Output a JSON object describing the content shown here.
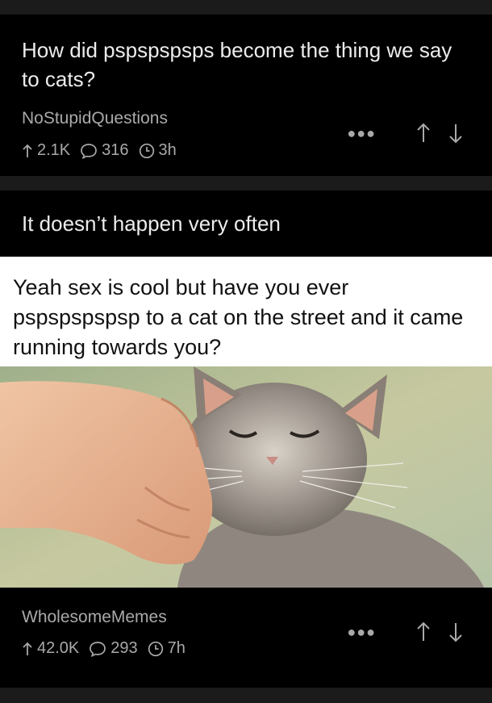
{
  "posts": [
    {
      "title": "How did pspspspsps become the thing we say to cats?",
      "subreddit": "NoStupidQuestions",
      "upvotes": "2.1K",
      "comments": "316",
      "age": "3h"
    },
    {
      "title": "It doesn’t happen very often",
      "meme_text": "Yeah sex is cool but have you ever pspspspspsp to a cat on the street and it came running towards you?",
      "subreddit": "WholesomeMemes",
      "upvotes": "42.0K",
      "comments": "293",
      "age": "7h"
    }
  ],
  "icons": {
    "upvote": "arrow-up-icon",
    "comment": "comment-bubble-icon",
    "time": "clock-icon",
    "more": "more-dots-icon",
    "vote_up": "vote-up-arrow-icon",
    "vote_down": "vote-down-arrow-icon"
  },
  "colors": {
    "background": "#000000",
    "separator": "#1b1b1b",
    "title": "#ececec",
    "meta": "#a9a9a9"
  }
}
